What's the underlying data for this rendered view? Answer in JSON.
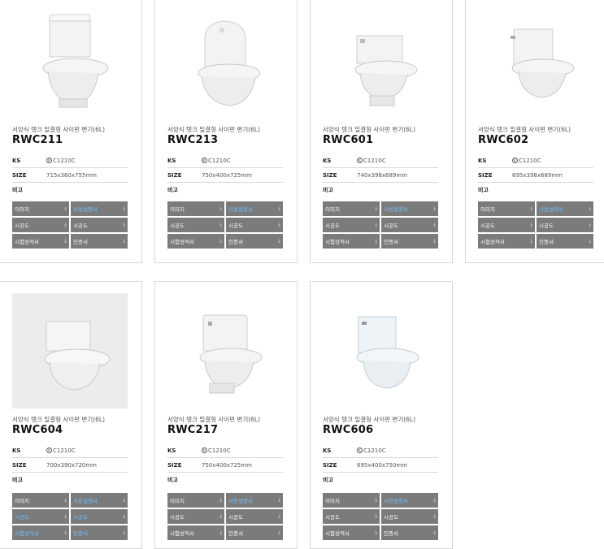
{
  "specs": {
    "ks_label": "KS",
    "size_label": "SIZE",
    "remark_label": "비고",
    "ks_mark": "K"
  },
  "downloads": {
    "icon": "download-arrow-icon"
  },
  "products": [
    {
      "subtitle": "서양식 탱크 밀결형 사이펀 변기(6L)",
      "model": "RWC211",
      "ks_value": "C1210C",
      "size_value": "715x360x755mm",
      "remark_value": "",
      "downloads": [
        {
          "label": "이미지",
          "active": false
        },
        {
          "label": "사용설명서",
          "active": true
        },
        {
          "label": "시공도",
          "active": false
        },
        {
          "label": "시공도",
          "active": false
        },
        {
          "label": "시험성적서",
          "active": false
        },
        {
          "label": "인증서",
          "active": false
        }
      ]
    },
    {
      "subtitle": "서양식 탱크 밀결형 사이펀 변기(6L)",
      "model": "RWC213",
      "ks_value": "C1210C",
      "size_value": "750x400x725mm",
      "remark_value": "",
      "downloads": [
        {
          "label": "이미지",
          "active": false
        },
        {
          "label": "사용설명서",
          "active": true
        },
        {
          "label": "시공도",
          "active": false
        },
        {
          "label": "시공도",
          "active": false
        },
        {
          "label": "시험성적서",
          "active": false
        },
        {
          "label": "인증서",
          "active": false
        }
      ]
    },
    {
      "subtitle": "서양식 탱크 밀결형 사이펀 변기(6L)",
      "model": "RWC601",
      "ks_value": "C1210C",
      "size_value": "740x398x689mm",
      "remark_value": "",
      "downloads": [
        {
          "label": "이미지",
          "active": false
        },
        {
          "label": "사용설명서",
          "active": true
        },
        {
          "label": "시공도",
          "active": false
        },
        {
          "label": "시공도",
          "active": false
        },
        {
          "label": "시험성적서",
          "active": false
        },
        {
          "label": "인증서",
          "active": false
        }
      ]
    },
    {
      "subtitle": "서양식 탱크 밀결형 사이펀 변기(6L)",
      "model": "RWC602",
      "ks_value": "C1210C",
      "size_value": "695x398x689mm",
      "remark_value": "",
      "downloads": [
        {
          "label": "이미지",
          "active": false
        },
        {
          "label": "사용설명서",
          "active": true
        },
        {
          "label": "시공도",
          "active": false
        },
        {
          "label": "시공도",
          "active": false
        },
        {
          "label": "시험성적서",
          "active": false
        },
        {
          "label": "인증서",
          "active": false
        }
      ]
    },
    {
      "subtitle": "서양식 탱크 밀결형 사이펀 변기(6L)",
      "model": "RWC604",
      "ks_value": "C1210C",
      "size_value": "700x390x720mm",
      "remark_value": "",
      "downloads": [
        {
          "label": "이미지",
          "active": false
        },
        {
          "label": "사용설명서",
          "active": true
        },
        {
          "label": "시공도",
          "active": true
        },
        {
          "label": "시공도",
          "active": true
        },
        {
          "label": "시험성적서",
          "active": true
        },
        {
          "label": "인증서",
          "active": true
        }
      ]
    },
    {
      "subtitle": "서양식 탱크 밀결형 사이펀 변기(6L)",
      "model": "RWC217",
      "ks_value": "C1210C",
      "size_value": "750x400x725mm",
      "remark_value": "",
      "downloads": [
        {
          "label": "이미지",
          "active": false
        },
        {
          "label": "사용설명서",
          "active": true
        },
        {
          "label": "시공도",
          "active": false
        },
        {
          "label": "시공도",
          "active": false
        },
        {
          "label": "시험성적서",
          "active": false
        },
        {
          "label": "인증서",
          "active": false
        }
      ]
    },
    {
      "subtitle": "서양식 탱크 밀결형 사이펀 변기(6L)",
      "model": "RWC606",
      "ks_value": "C1210C",
      "size_value": "695x400x750mm",
      "remark_value": "",
      "downloads": [
        {
          "label": "이미지",
          "active": false
        },
        {
          "label": "사용설명서",
          "active": true
        },
        {
          "label": "시공도",
          "active": false
        },
        {
          "label": "시공도",
          "active": false
        },
        {
          "label": "시험성적서",
          "active": false
        },
        {
          "label": "인증서",
          "active": false
        }
      ]
    }
  ]
}
